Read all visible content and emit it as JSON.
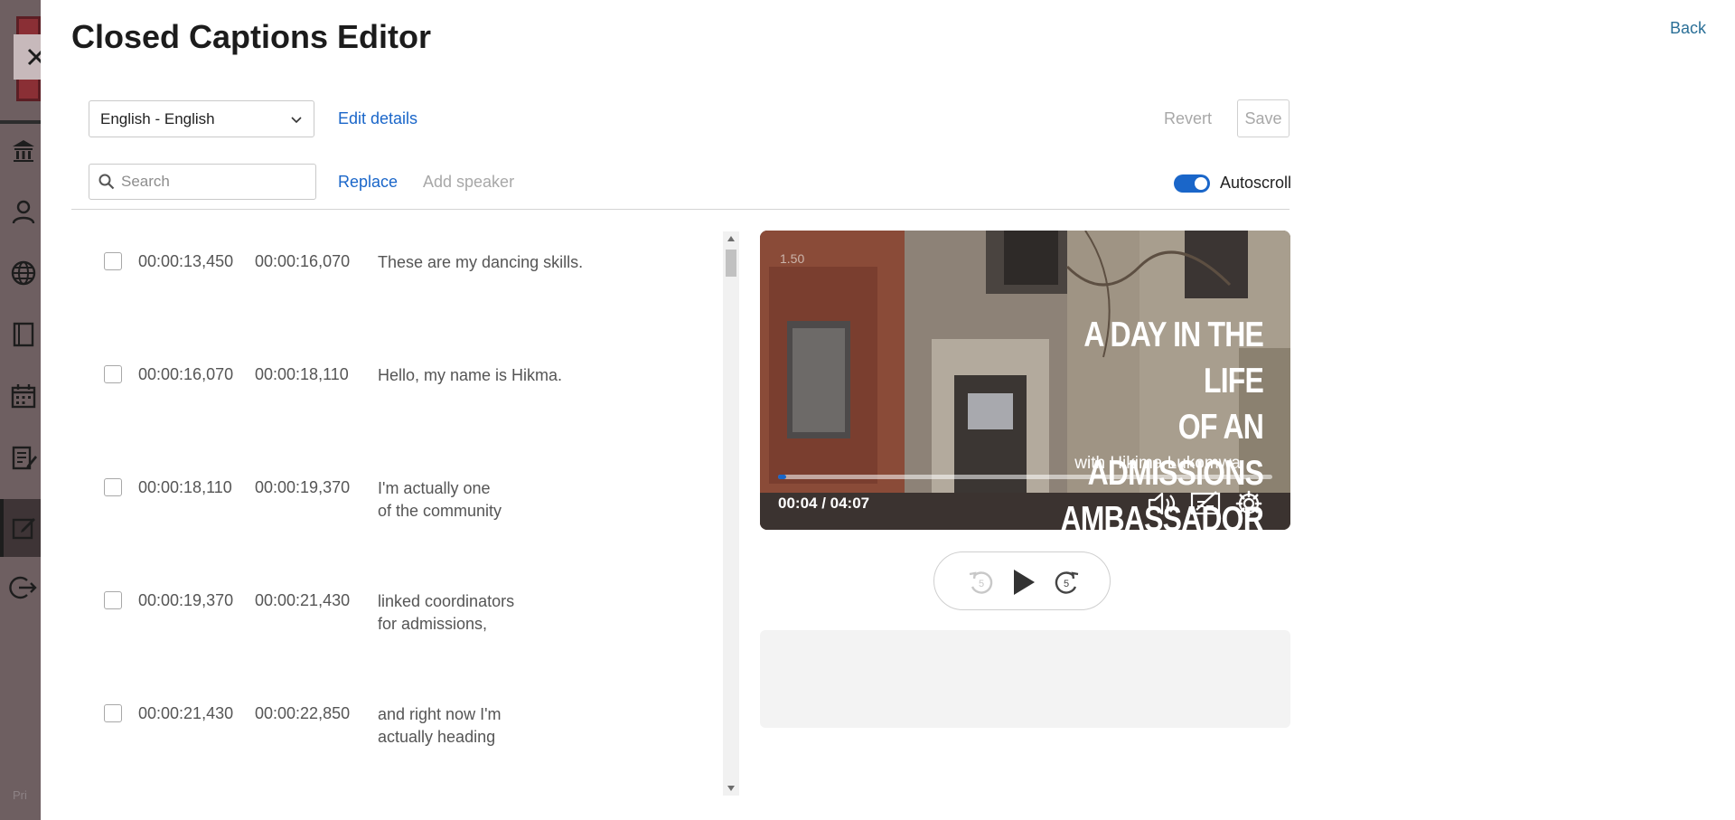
{
  "page": {
    "title": "Closed Captions Editor",
    "back_label": "Back",
    "close_icon": "close-icon"
  },
  "app_sidebar": {
    "privacy_label": "Pri",
    "nav_icons": [
      "institution-icon",
      "user-icon",
      "globe-icon",
      "book-icon",
      "calendar-icon",
      "document-edit-icon",
      "edit-icon",
      "logout-icon"
    ]
  },
  "toolbar": {
    "language_value": "English - English",
    "edit_details_label": "Edit details",
    "revert_label": "Revert",
    "save_label": "Save",
    "search_placeholder": "Search",
    "search_value": "",
    "replace_label": "Replace",
    "add_speaker_label": "Add speaker",
    "autoscroll_label": "Autoscroll",
    "autoscroll_on": true
  },
  "captions": [
    {
      "start": "00:00:13,450",
      "end": "00:00:16,070",
      "text": "These are my dancing skills."
    },
    {
      "start": "00:00:16,070",
      "end": "00:00:18,110",
      "text": "Hello, my name is Hikma."
    },
    {
      "start": "00:00:18,110",
      "end": "00:00:19,370",
      "text": "I'm actually one\nof the community"
    },
    {
      "start": "00:00:19,370",
      "end": "00:00:21,430",
      "text": "linked coordinators\nfor admissions,"
    },
    {
      "start": "00:00:21,430",
      "end": "00:00:22,850",
      "text": "and right now I'm\nactually heading"
    }
  ],
  "video": {
    "speed_label": "1.50",
    "title_line1": "A DAY IN THE LIFE",
    "title_line2": "OF AN ADMISSIONS",
    "title_line3": "AMBASSADOR",
    "subtitle": "with Hikima Lukomwa",
    "timecode": "00:04 / 04:07",
    "progress_fraction": 0.016,
    "controls": [
      "volume-icon",
      "captions-off-icon",
      "settings-gear-icon"
    ]
  },
  "transport": {
    "buttons": [
      "rewind-5-icon",
      "play-icon",
      "forward-5-icon"
    ],
    "skip_seconds": "5"
  },
  "colors": {
    "accent": "#1a66c9",
    "back_link": "#2a6f97",
    "disabled_text": "#a8a8a8"
  }
}
